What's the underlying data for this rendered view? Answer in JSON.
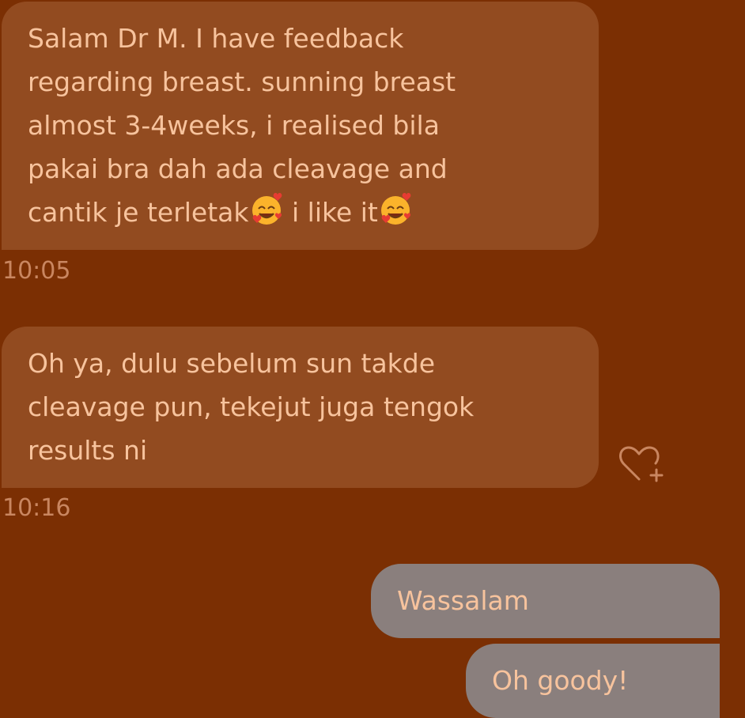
{
  "messages": [
    {
      "direction": "incoming",
      "lines": [
        "Salam Dr M. I have feedback",
        "regarding breast.  sunning breast",
        "almost 3-4weeks, i realised bila",
        "pakai bra dah ada cleavage and"
      ],
      "last_line_a": "cantik je terletak",
      "last_line_b": " i like it",
      "emoji": "smiling-face-with-hearts",
      "time": "10:05"
    },
    {
      "direction": "incoming",
      "lines": [
        "Oh ya, dulu sebelum sun takde",
        "cleavage pun, tekejut juga tengok",
        "results ni"
      ],
      "time": "10:16"
    },
    {
      "direction": "outgoing",
      "text": "Wassalam"
    },
    {
      "direction": "outgoing",
      "text": "Oh goody!"
    }
  ],
  "icons": {
    "react": "heart-plus-icon",
    "emoji": "smiling-face-with-hearts"
  },
  "colors": {
    "background": "#7b2f03",
    "incoming_bubble": "#924b20",
    "outgoing_bubble": "#8a7f7d",
    "text": "#f7c39d",
    "timestamp": "#c98660"
  }
}
